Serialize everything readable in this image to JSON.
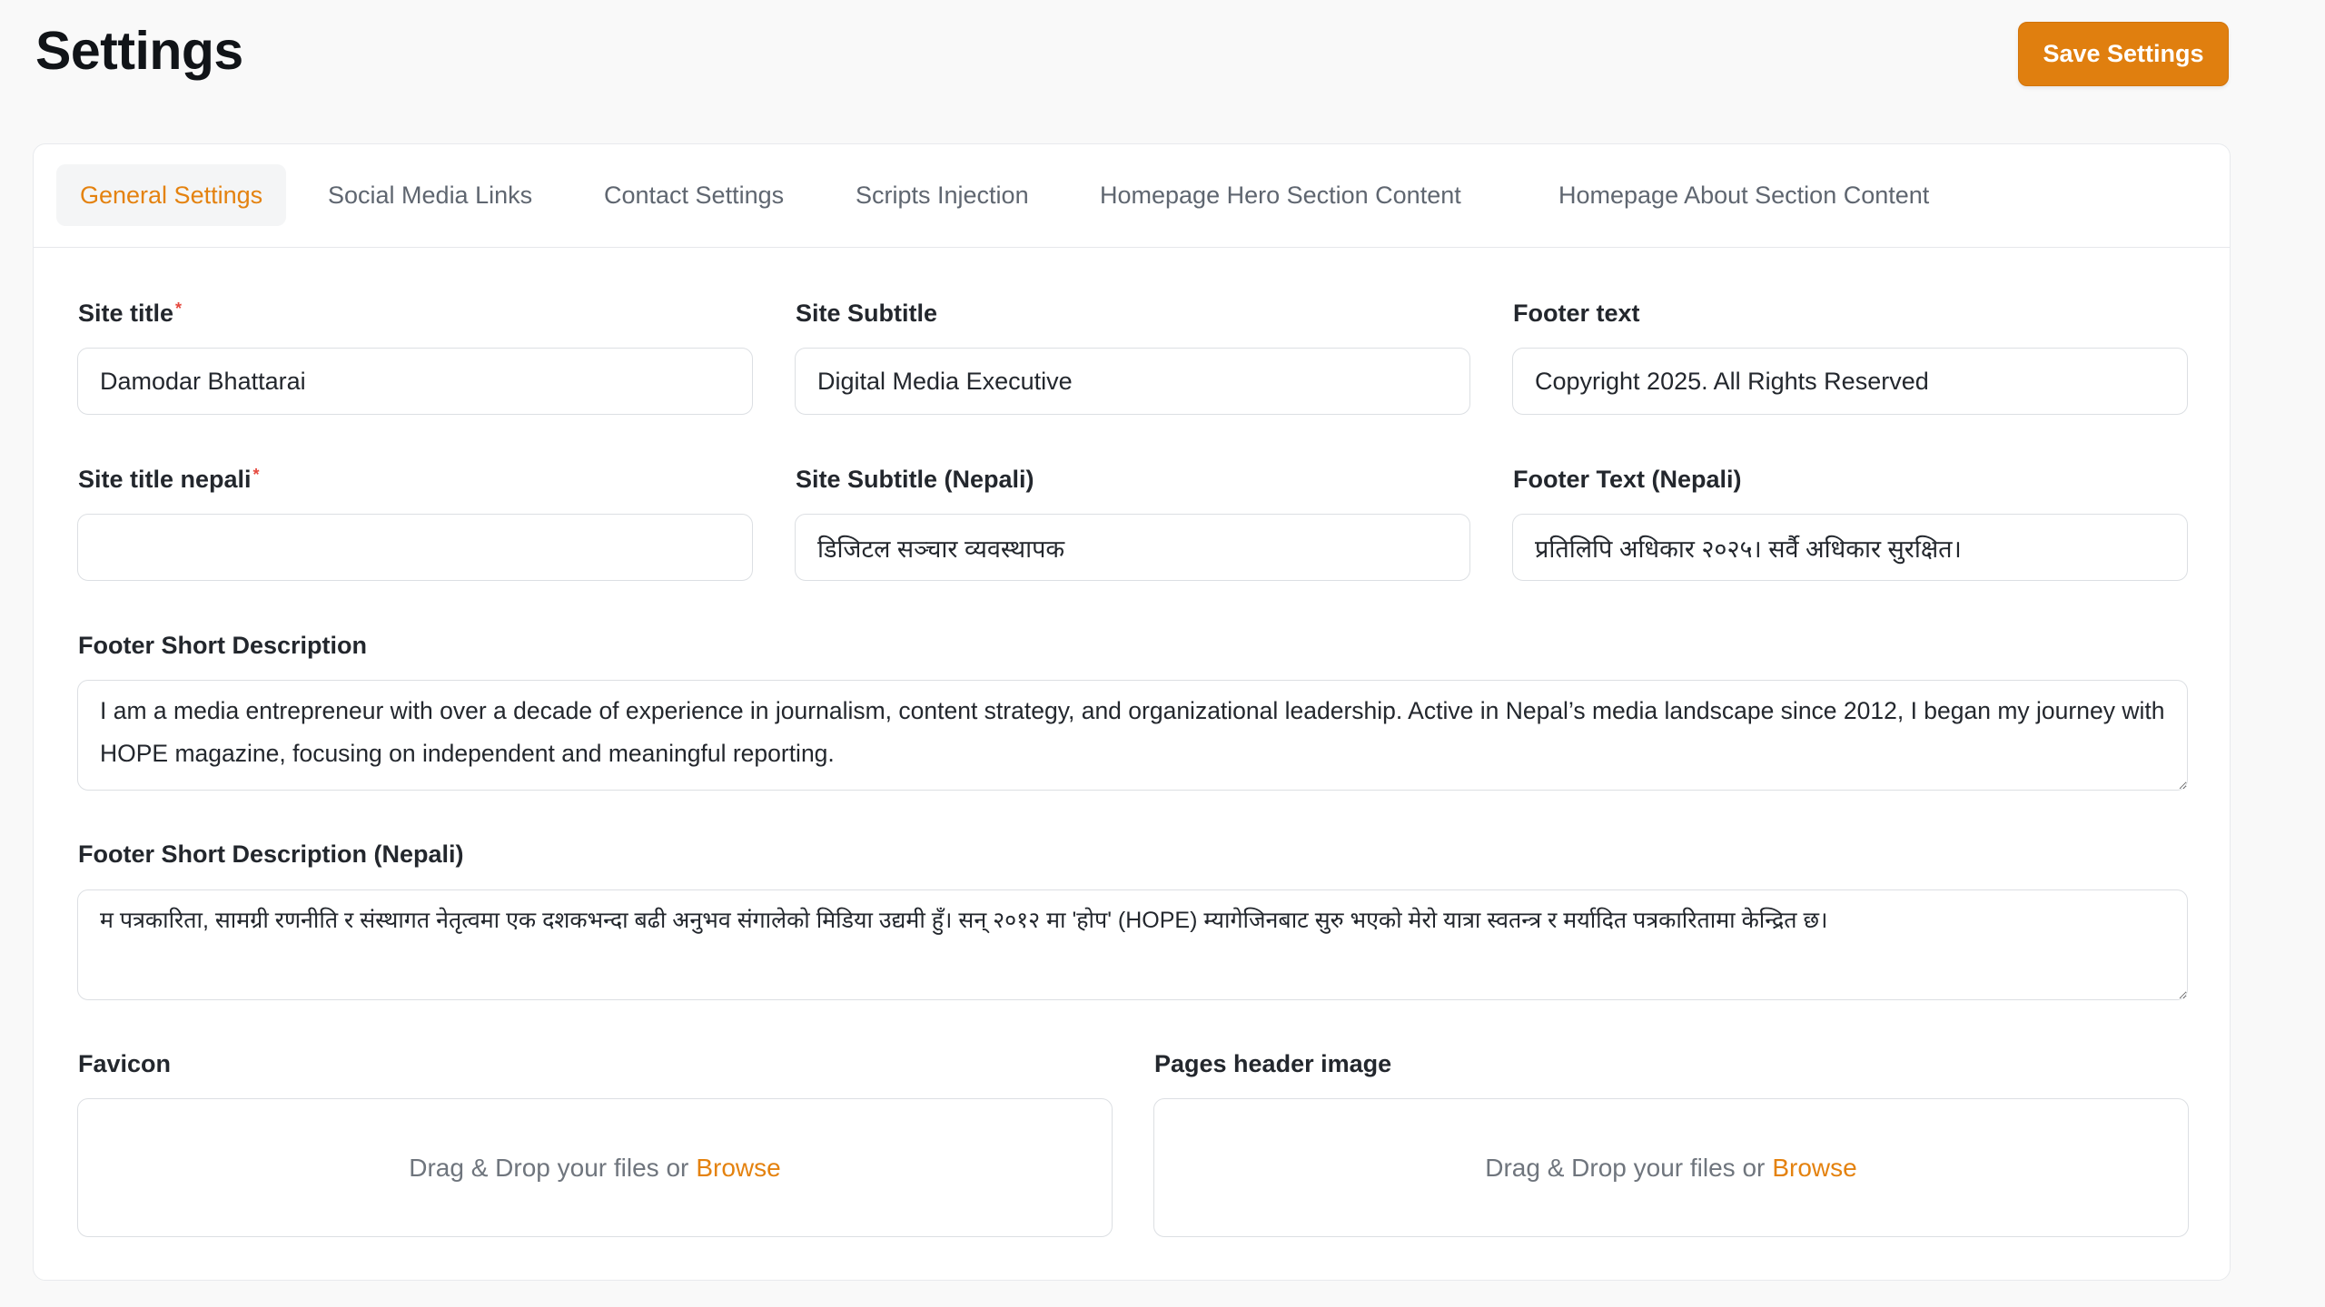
{
  "page": {
    "title": "Settings"
  },
  "toolbar": {
    "save_label": "Save Settings"
  },
  "tabs": [
    {
      "label": "General Settings",
      "active": true
    },
    {
      "label": "Social Media Links",
      "active": false
    },
    {
      "label": "Contact Settings",
      "active": false
    },
    {
      "label": "Scripts Injection",
      "active": false
    },
    {
      "label": "Homepage Hero Section Content",
      "active": false
    },
    {
      "label": "Homepage About Section Content",
      "active": false
    }
  ],
  "fields": {
    "site_title": {
      "label": "Site title",
      "required_mark": "*",
      "value": "Damodar Bhattarai"
    },
    "site_subtitle": {
      "label": "Site Subtitle",
      "value": "Digital Media Executive"
    },
    "footer_text": {
      "label": "Footer text",
      "value": "Copyright 2025. All Rights Reserved"
    },
    "site_title_nepali": {
      "label": "Site title nepali",
      "required_mark": "*",
      "value": ""
    },
    "site_subtitle_nepali": {
      "label": "Site Subtitle (Nepali)",
      "value": "डिजिटल सञ्चार व्यवस्थापक"
    },
    "footer_text_nepali": {
      "label": "Footer Text (Nepali)",
      "value": "प्रतिलिपि अधिकार २०२५। सर्वै अधिकार सुरक्षित।"
    },
    "footer_short_description": {
      "label": "Footer Short Description",
      "value": "I am a media entrepreneur with over a decade of experience in journalism, content strategy, and organizational leadership. Active in Nepal’s media landscape since 2012, I began my journey with HOPE magazine, focusing on independent and meaningful reporting."
    },
    "footer_short_description_nepali": {
      "label": "Footer Short Description (Nepali)",
      "value": "म पत्रकारिता, सामग्री रणनीति र संस्थागत नेतृत्वमा एक दशकभन्दा बढी अनुभव संगालेको मिडिया उद्यमी हुँ। सन् २०१२ मा 'होप' (HOPE) म्यागेजिनबाट सुरु भएको मेरो यात्रा स्वतन्त्र र मर्यादित पत्रकारितामा केन्द्रित छ।"
    },
    "favicon": {
      "label": "Favicon",
      "drop_text": "Drag & Drop your files or",
      "browse_label": "Browse"
    },
    "pages_header_image": {
      "label": "Pages header image",
      "drop_text": "Drag & Drop your files or",
      "browse_label": "Browse"
    }
  },
  "colors": {
    "accent": "#e07f0f",
    "required": "#e5483e",
    "background": "#f9f9f9"
  }
}
